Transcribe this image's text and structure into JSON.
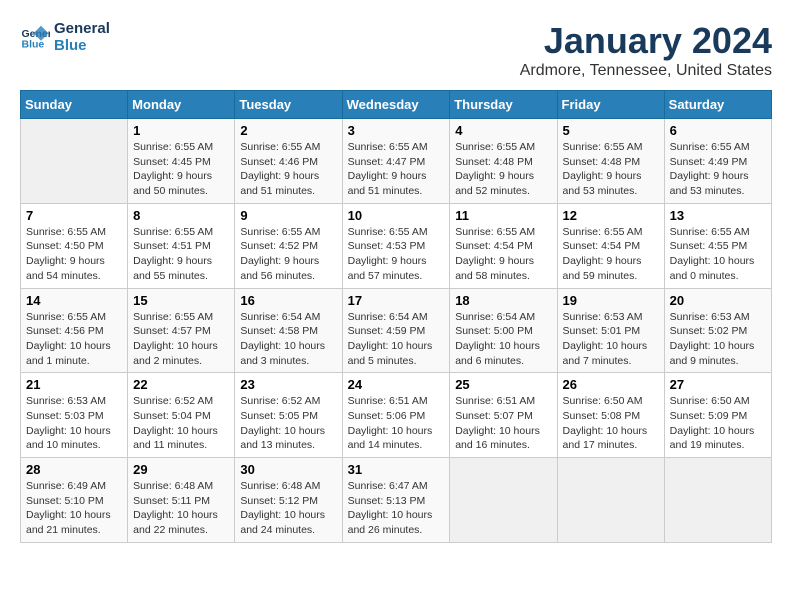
{
  "app": {
    "name_line1": "General",
    "name_line2": "Blue"
  },
  "title": "January 2024",
  "location": "Ardmore, Tennessee, United States",
  "days_of_week": [
    "Sunday",
    "Monday",
    "Tuesday",
    "Wednesday",
    "Thursday",
    "Friday",
    "Saturday"
  ],
  "weeks": [
    [
      {
        "num": "",
        "data": ""
      },
      {
        "num": "1",
        "data": "Sunrise: 6:55 AM\nSunset: 4:45 PM\nDaylight: 9 hours\nand 50 minutes."
      },
      {
        "num": "2",
        "data": "Sunrise: 6:55 AM\nSunset: 4:46 PM\nDaylight: 9 hours\nand 51 minutes."
      },
      {
        "num": "3",
        "data": "Sunrise: 6:55 AM\nSunset: 4:47 PM\nDaylight: 9 hours\nand 51 minutes."
      },
      {
        "num": "4",
        "data": "Sunrise: 6:55 AM\nSunset: 4:48 PM\nDaylight: 9 hours\nand 52 minutes."
      },
      {
        "num": "5",
        "data": "Sunrise: 6:55 AM\nSunset: 4:48 PM\nDaylight: 9 hours\nand 53 minutes."
      },
      {
        "num": "6",
        "data": "Sunrise: 6:55 AM\nSunset: 4:49 PM\nDaylight: 9 hours\nand 53 minutes."
      }
    ],
    [
      {
        "num": "7",
        "data": "Sunrise: 6:55 AM\nSunset: 4:50 PM\nDaylight: 9 hours\nand 54 minutes."
      },
      {
        "num": "8",
        "data": "Sunrise: 6:55 AM\nSunset: 4:51 PM\nDaylight: 9 hours\nand 55 minutes."
      },
      {
        "num": "9",
        "data": "Sunrise: 6:55 AM\nSunset: 4:52 PM\nDaylight: 9 hours\nand 56 minutes."
      },
      {
        "num": "10",
        "data": "Sunrise: 6:55 AM\nSunset: 4:53 PM\nDaylight: 9 hours\nand 57 minutes."
      },
      {
        "num": "11",
        "data": "Sunrise: 6:55 AM\nSunset: 4:54 PM\nDaylight: 9 hours\nand 58 minutes."
      },
      {
        "num": "12",
        "data": "Sunrise: 6:55 AM\nSunset: 4:54 PM\nDaylight: 9 hours\nand 59 minutes."
      },
      {
        "num": "13",
        "data": "Sunrise: 6:55 AM\nSunset: 4:55 PM\nDaylight: 10 hours\nand 0 minutes."
      }
    ],
    [
      {
        "num": "14",
        "data": "Sunrise: 6:55 AM\nSunset: 4:56 PM\nDaylight: 10 hours\nand 1 minute."
      },
      {
        "num": "15",
        "data": "Sunrise: 6:55 AM\nSunset: 4:57 PM\nDaylight: 10 hours\nand 2 minutes."
      },
      {
        "num": "16",
        "data": "Sunrise: 6:54 AM\nSunset: 4:58 PM\nDaylight: 10 hours\nand 3 minutes."
      },
      {
        "num": "17",
        "data": "Sunrise: 6:54 AM\nSunset: 4:59 PM\nDaylight: 10 hours\nand 5 minutes."
      },
      {
        "num": "18",
        "data": "Sunrise: 6:54 AM\nSunset: 5:00 PM\nDaylight: 10 hours\nand 6 minutes."
      },
      {
        "num": "19",
        "data": "Sunrise: 6:53 AM\nSunset: 5:01 PM\nDaylight: 10 hours\nand 7 minutes."
      },
      {
        "num": "20",
        "data": "Sunrise: 6:53 AM\nSunset: 5:02 PM\nDaylight: 10 hours\nand 9 minutes."
      }
    ],
    [
      {
        "num": "21",
        "data": "Sunrise: 6:53 AM\nSunset: 5:03 PM\nDaylight: 10 hours\nand 10 minutes."
      },
      {
        "num": "22",
        "data": "Sunrise: 6:52 AM\nSunset: 5:04 PM\nDaylight: 10 hours\nand 11 minutes."
      },
      {
        "num": "23",
        "data": "Sunrise: 6:52 AM\nSunset: 5:05 PM\nDaylight: 10 hours\nand 13 minutes."
      },
      {
        "num": "24",
        "data": "Sunrise: 6:51 AM\nSunset: 5:06 PM\nDaylight: 10 hours\nand 14 minutes."
      },
      {
        "num": "25",
        "data": "Sunrise: 6:51 AM\nSunset: 5:07 PM\nDaylight: 10 hours\nand 16 minutes."
      },
      {
        "num": "26",
        "data": "Sunrise: 6:50 AM\nSunset: 5:08 PM\nDaylight: 10 hours\nand 17 minutes."
      },
      {
        "num": "27",
        "data": "Sunrise: 6:50 AM\nSunset: 5:09 PM\nDaylight: 10 hours\nand 19 minutes."
      }
    ],
    [
      {
        "num": "28",
        "data": "Sunrise: 6:49 AM\nSunset: 5:10 PM\nDaylight: 10 hours\nand 21 minutes."
      },
      {
        "num": "29",
        "data": "Sunrise: 6:48 AM\nSunset: 5:11 PM\nDaylight: 10 hours\nand 22 minutes."
      },
      {
        "num": "30",
        "data": "Sunrise: 6:48 AM\nSunset: 5:12 PM\nDaylight: 10 hours\nand 24 minutes."
      },
      {
        "num": "31",
        "data": "Sunrise: 6:47 AM\nSunset: 5:13 PM\nDaylight: 10 hours\nand 26 minutes."
      },
      {
        "num": "",
        "data": ""
      },
      {
        "num": "",
        "data": ""
      },
      {
        "num": "",
        "data": ""
      }
    ]
  ]
}
